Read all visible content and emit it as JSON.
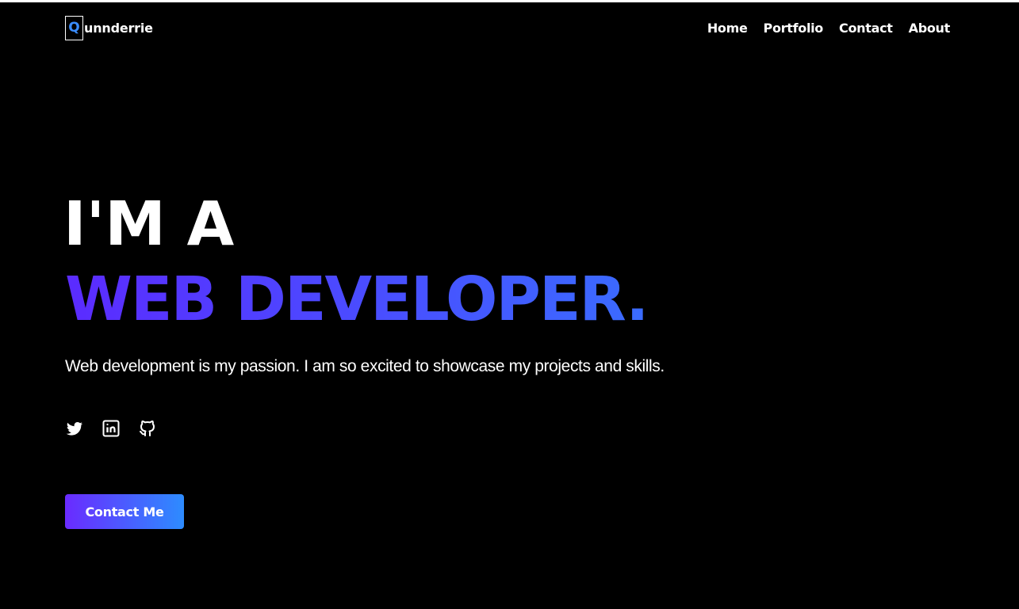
{
  "brand": {
    "mark": "Q",
    "name": "unnderrie",
    "mark_color": "#3a8dff"
  },
  "nav": {
    "items": [
      {
        "label": "Home"
      },
      {
        "label": "Portfolio"
      },
      {
        "label": "Contact"
      },
      {
        "label": "About"
      }
    ]
  },
  "hero": {
    "line1": "I'M A",
    "line2": "WEB DEVELOPER.",
    "description": "Web development is my passion. I am so excited to showcase my projects and skills.",
    "gradient": [
      "#5b2bff",
      "#3a6cff"
    ]
  },
  "socials": [
    {
      "icon": "twitter-icon"
    },
    {
      "icon": "linkedin-icon"
    },
    {
      "icon": "github-icon"
    }
  ],
  "cta": {
    "label": "Contact Me",
    "gradient": [
      "#6a2bff",
      "#2d8cff"
    ]
  }
}
